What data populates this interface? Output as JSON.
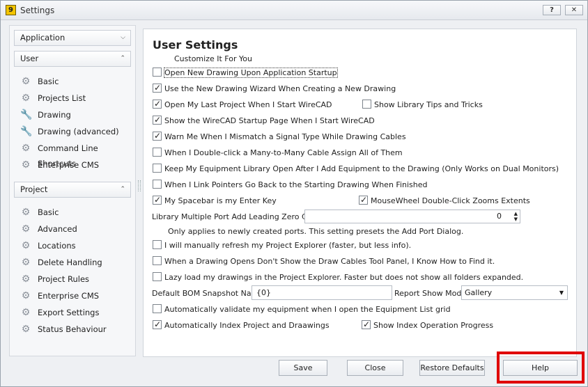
{
  "window": {
    "title": "Settings",
    "app_icon_text": "9",
    "help_btn": "?",
    "close_btn": "✕"
  },
  "sidebar": {
    "application": {
      "label": "Application",
      "chevron": "⌄"
    },
    "user": {
      "label": "User",
      "chevron": "⌃",
      "items": [
        "Basic",
        "Projects List",
        "Drawing",
        "Drawing (advanced)",
        "Command Line Shortcuts",
        "Enterprise CMS"
      ],
      "icons": [
        "gear-icon",
        "gear-icon",
        "wrench-icon",
        "wrench-icon",
        "gear-icon",
        "gear-icon"
      ]
    },
    "project": {
      "label": "Project",
      "chevron": "⌃",
      "items": [
        "Basic",
        "Advanced",
        "Locations",
        "Delete Handling",
        "Project Rules",
        "Enterprise CMS",
        "Export Settings",
        "Status Behaviour"
      ]
    }
  },
  "main": {
    "title": "User Settings",
    "subtitle": "Customize It For You",
    "options": {
      "open_new_drawing": {
        "label": "Open New Drawing Upon Application Startup",
        "checked": false
      },
      "new_drawing_wizard": {
        "label": "Use the New Drawing Wizard When Creating a New Drawing",
        "checked": true
      },
      "open_last_project": {
        "label": "Open My Last Project When I Start WireCAD",
        "checked": true
      },
      "library_tips": {
        "label": "Show Library Tips and Tricks",
        "checked": false
      },
      "startup_page": {
        "label": "Show the WireCAD Startup Page When I Start WireCAD",
        "checked": true
      },
      "mismatch_warn": {
        "label": "Warn Me When I Mismatch a Signal Type While Drawing Cables",
        "checked": true
      },
      "many_to_many": {
        "label": "When I Double-click a Many-to-Many Cable Assign All of Them",
        "checked": false
      },
      "keep_library_open": {
        "label": "Keep My Equipment Library Open After I Add Equipment to the Drawing (Only Works on Dual Monitors)",
        "checked": false
      },
      "link_pointers": {
        "label": "When I Link Pointers Go Back to the Starting Drawing When Finished",
        "checked": false
      },
      "spacebar_enter": {
        "label": "My Spacebar is my Enter Key",
        "checked": true
      },
      "mousewheel_zoom": {
        "label": "MouseWheel Double-Click Zooms Extents",
        "checked": true
      },
      "manual_refresh": {
        "label": "I will manually refresh my Project Explorer (faster, but less info).",
        "checked": false
      },
      "hide_draw_cables": {
        "label": "When a Drawing Opens Don't Show the Draw Cables Tool Panel, I Know How to Find it.",
        "checked": false
      },
      "lazy_load": {
        "label": "Lazy load my drawings in the Project Explorer. Faster but does not show all folders expanded.",
        "checked": false
      },
      "auto_validate": {
        "label": "Automatically validate my equipment when I open the Equipment List grid",
        "checked": false
      },
      "auto_index": {
        "label": "Automatically Index Project and Draawings",
        "checked": true
      },
      "show_index_progress": {
        "label": "Show Index Operation Progress",
        "checked": true
      }
    },
    "leading_zero": {
      "label": "Library Multiple Port Add Leading Zero Count",
      "value": "0",
      "note": "Only applies to newly created ports. This setting presets the Add Port Dialog."
    },
    "bom": {
      "label": "Default BOM Snapshot Name",
      "value": "{0}"
    },
    "report_mode": {
      "label": "Report Show Mode",
      "value": "Gallery"
    }
  },
  "footer": {
    "save": "Save",
    "close": "Close",
    "restore": "Restore Defaults",
    "help": "Help"
  },
  "colors": {
    "highlight": "#e00000"
  }
}
